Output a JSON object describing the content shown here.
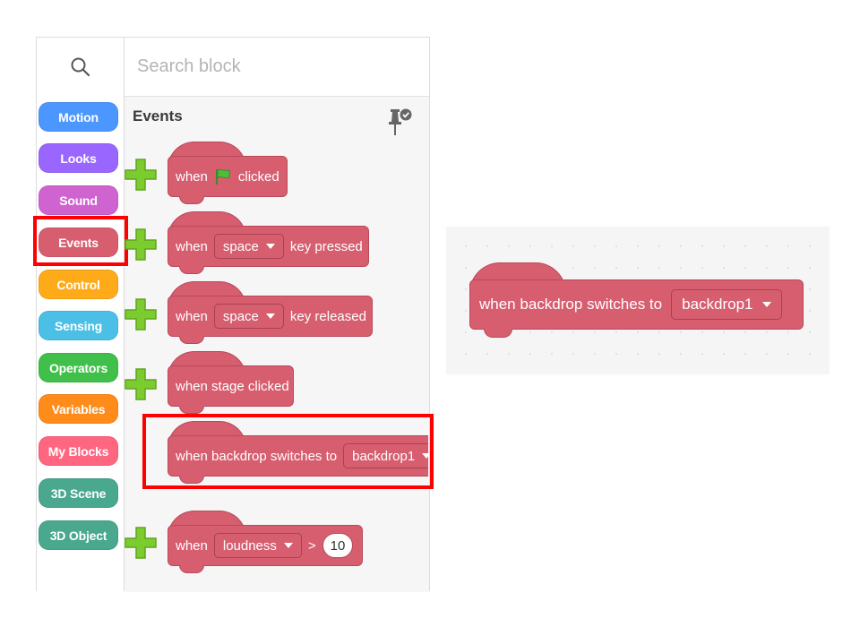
{
  "search": {
    "placeholder": "Search block"
  },
  "categories": [
    {
      "label": "Motion",
      "color": "#4c97ff"
    },
    {
      "label": "Looks",
      "color": "#9966ff"
    },
    {
      "label": "Sound",
      "color": "#cf63cf"
    },
    {
      "label": "Events",
      "color": "#d65e6f",
      "selected": true
    },
    {
      "label": "Control",
      "color": "#ffab19"
    },
    {
      "label": "Sensing",
      "color": "#4cbfe6"
    },
    {
      "label": "Operators",
      "color": "#40bf4a"
    },
    {
      "label": "Variables",
      "color": "#ff8c1a"
    },
    {
      "label": "My Blocks",
      "color": "#ff6680"
    },
    {
      "label": "3D Scene",
      "color": "#4aa88f"
    },
    {
      "label": "3D Object",
      "color": "#4aa88f"
    }
  ],
  "section": {
    "title": "Events",
    "pin_icon": "pin-check-icon"
  },
  "blocks": {
    "flag_clicked": {
      "when": "when",
      "clicked": "clicked",
      "icon": "green-flag-icon"
    },
    "key_pressed": {
      "when": "when",
      "key": "space",
      "suffix": "key pressed"
    },
    "key_released": {
      "when": "when",
      "key": "space",
      "suffix": "key released"
    },
    "stage_clicked": {
      "label": "when stage clicked"
    },
    "backdrop_switches": {
      "label": "when backdrop switches to",
      "value": "backdrop1"
    },
    "loudness": {
      "when": "when",
      "sensor": "loudness",
      "op": ">",
      "value": "10"
    }
  },
  "preview": {
    "label": "when backdrop switches to",
    "value": "backdrop1"
  },
  "colors": {
    "events_block": "#d65e6f",
    "highlight": "#ff0000",
    "add_icon": "#7ccb2f"
  }
}
